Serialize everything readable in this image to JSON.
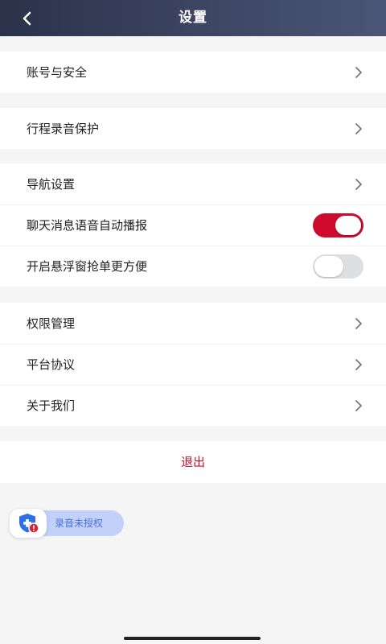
{
  "header": {
    "title": "设置"
  },
  "groups": {
    "account": {
      "label": "账号与安全"
    },
    "trip": {
      "label": "行程录音保护"
    },
    "nav": {
      "navigation": {
        "label": "导航设置"
      },
      "voice": {
        "label": "聊天消息语音自动播报",
        "on": true
      },
      "float": {
        "label": "开启悬浮窗抢单更方便",
        "on": false
      }
    },
    "misc": {
      "permissions": {
        "label": "权限管理"
      },
      "agreement": {
        "label": "平台协议"
      },
      "about": {
        "label": "关于我们"
      }
    }
  },
  "logout": {
    "label": "退出"
  },
  "recording_badge": {
    "label": "录音未授权"
  },
  "colors": {
    "accent": "#cf0a2c",
    "header": "#3d4663",
    "badge": "#c2d1f9"
  }
}
